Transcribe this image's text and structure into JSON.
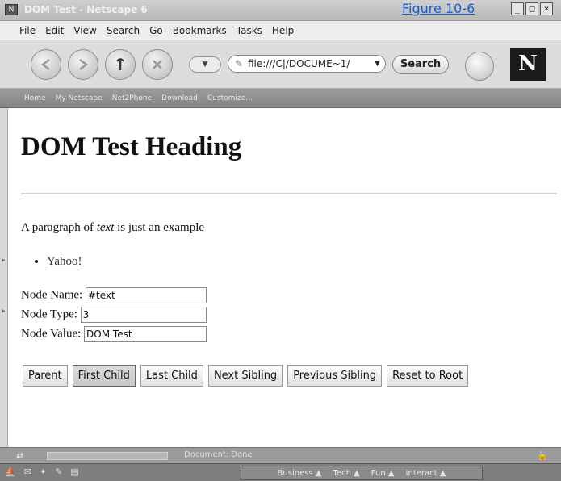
{
  "window": {
    "title": "DOM Test - Netscape 6",
    "title_link": "Figure 10-6",
    "buttons": [
      "_",
      "□",
      "×"
    ]
  },
  "menubar": {
    "items": [
      "File",
      "Edit",
      "View",
      "Search",
      "Go",
      "Bookmarks",
      "Tasks",
      "Help"
    ]
  },
  "navbar": {
    "url": "file:///C|/DOCUME~1/",
    "search_label": "Search",
    "logo": "N",
    "icons": [
      "back-icon",
      "forward-icon",
      "reload-icon",
      "stop-icon",
      "print-icon"
    ]
  },
  "bookmarks": {
    "items": [
      "Home",
      "My Netscape",
      "Net2Phone",
      "Download",
      "Customize..."
    ]
  },
  "content": {
    "heading": "DOM Test Heading",
    "paragraph_before": "A paragraph of ",
    "paragraph_em": "text",
    "paragraph_after": " is just an example",
    "link": "Yahoo!",
    "node_name_label": "Node Name:",
    "node_name_value": "#text",
    "node_type_label": "Node Type:",
    "node_type_value": "3",
    "node_value_label": "Node Value:",
    "node_value_value": "DOM Test",
    "buttons": [
      "Parent",
      "First Child",
      "Last Child",
      "Next Sibling",
      "Previous Sibling",
      "Reset to Root"
    ],
    "active_button": "First Child"
  },
  "statusbar": {
    "text": "Document: Done"
  },
  "taskbar": {
    "channels": [
      "Business ▲",
      "Tech ▲",
      "Fun ▲",
      "Interact ▲"
    ]
  }
}
